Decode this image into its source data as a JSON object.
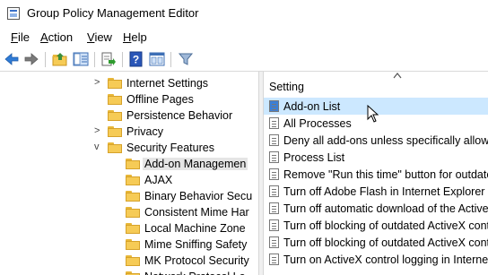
{
  "window": {
    "title": "Group Policy Management Editor"
  },
  "menu": {
    "file": {
      "u": "F",
      "rest": "ile"
    },
    "action": {
      "u": "A",
      "rest": "ction"
    },
    "view": {
      "u": "V",
      "rest": "iew"
    },
    "help": {
      "u": "H",
      "rest": "elp"
    }
  },
  "tree": {
    "items": [
      {
        "label": "Internet Settings",
        "expander": ">"
      },
      {
        "label": "Offline Pages",
        "expander": ""
      },
      {
        "label": "Persistence Behavior",
        "expander": ""
      },
      {
        "label": "Privacy",
        "expander": ">"
      },
      {
        "label": "Security Features",
        "expander": "v"
      },
      {
        "label": "Add-on Managemen",
        "expander": ""
      },
      {
        "label": "AJAX",
        "expander": ""
      },
      {
        "label": "Binary Behavior Secu",
        "expander": ""
      },
      {
        "label": "Consistent Mime Har",
        "expander": ""
      },
      {
        "label": "Local Machine Zone",
        "expander": ""
      },
      {
        "label": "Mime Sniffing Safety",
        "expander": ""
      },
      {
        "label": "MK Protocol Security",
        "expander": ""
      },
      {
        "label": "Network Protocol Lo",
        "expander": ""
      }
    ]
  },
  "settings": {
    "column_header": "Setting",
    "items": [
      "Add-on List",
      "All Processes",
      "Deny all add-ons unless specifically allowed",
      "Process List",
      "Remove \"Run this time\" button for outdate",
      "Turn off Adobe Flash in Internet Explorer an",
      "Turn off automatic download of the ActiveX",
      "Turn off blocking of outdated ActiveX cont",
      "Turn off blocking of outdated ActiveX cont",
      "Turn on ActiveX control logging in Internet"
    ]
  },
  "colors": {
    "selection": "#cce8ff",
    "tree_selection": "#e5e5e5",
    "folder": "#f6cb56"
  }
}
